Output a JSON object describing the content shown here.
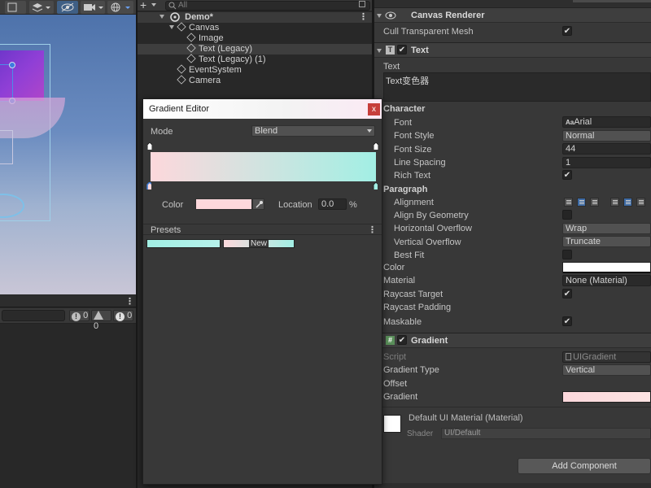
{
  "hierarchy": {
    "search_placeholder": "All",
    "scene_name": "Demo*",
    "items": [
      {
        "label": "Canvas"
      },
      {
        "label": "Image"
      },
      {
        "label": "Text (Legacy)"
      },
      {
        "label": "Text (Legacy) (1)"
      },
      {
        "label": "EventSystem"
      },
      {
        "label": "Camera"
      }
    ]
  },
  "console": {
    "log_count": "0",
    "warning_count": "0",
    "error_count": "0"
  },
  "gradient_editor": {
    "title": "Gradient Editor",
    "close_label": "x",
    "mode_label": "Mode",
    "mode_value": "Blend",
    "color_label": "Color",
    "color_value": "#fdd8dc",
    "location_label": "Location",
    "location_value": "0.0",
    "location_unit": "%",
    "presets_label": "Presets",
    "new_label": "New",
    "gradient_start": "#fdd8dc",
    "gradient_end": "#a2efe4"
  },
  "inspector": {
    "canvas_renderer": {
      "title": "Canvas Renderer",
      "cull_label": "Cull Transparent Mesh"
    },
    "text": {
      "title": "Text",
      "text_label": "Text",
      "text_value": "Text变色器",
      "character_label": "Character",
      "font_label": "Font",
      "font_value": "Arial",
      "font_icon": "Aa",
      "font_style_label": "Font Style",
      "font_style_value": "Normal",
      "font_size_label": "Font Size",
      "font_size_value": "44",
      "line_spacing_label": "Line Spacing",
      "line_spacing_value": "1",
      "rich_text_label": "Rich Text",
      "paragraph_label": "Paragraph",
      "alignment_label": "Alignment",
      "align_geometry_label": "Align By Geometry",
      "horizontal_overflow_label": "Horizontal Overflow",
      "horizontal_overflow_value": "Wrap",
      "vertical_overflow_label": "Vertical Overflow",
      "vertical_overflow_value": "Truncate",
      "best_fit_label": "Best Fit",
      "color_label": "Color",
      "material_label": "Material",
      "material_value": "None (Material)",
      "raycast_target_label": "Raycast Target",
      "raycast_padding_label": "Raycast Padding",
      "maskable_label": "Maskable"
    },
    "gradient": {
      "title": "Gradient",
      "script_label": "Script",
      "script_value": "UIGradient",
      "gradient_type_label": "Gradient Type",
      "gradient_type_value": "Vertical",
      "offset_label": "Offset",
      "gradient_label": "Gradient"
    },
    "material": {
      "name": "Default UI Material (Material)",
      "shader_label": "Shader",
      "shader_value": "UI/Default"
    },
    "add_component_label": "Add Component"
  }
}
